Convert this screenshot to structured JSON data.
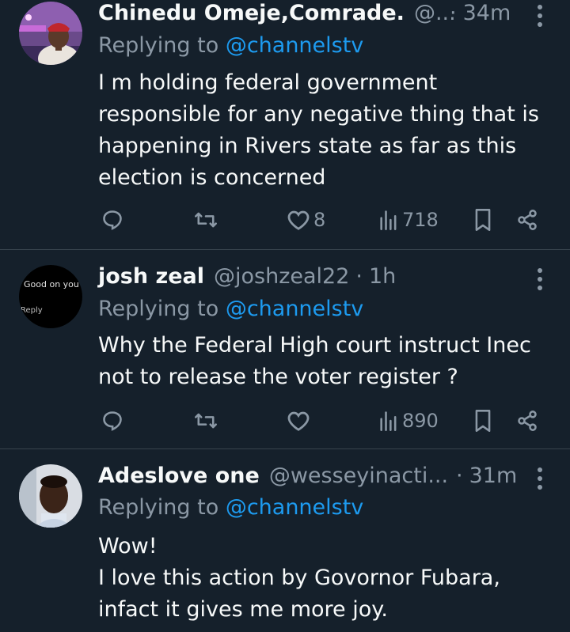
{
  "replying_prefix": "Replying to ",
  "colors": {
    "background": "#15202b",
    "primary_text": "#f7f9f9",
    "secondary_text": "#8b98a5",
    "link": "#1d9bf0",
    "divider": "#38444d"
  },
  "tweets": [
    {
      "name": "Chinedu Omeje,Comrade.",
      "handle": "@...",
      "dot": "·",
      "time": "34m",
      "reply_to": "@channelstv",
      "body": "I m holding federal government responsible for any negative thing that is happening in Rivers state as far as this election is concerned",
      "likes": "8",
      "views": "718"
    },
    {
      "name": "josh zeal",
      "handle": "@joshzeal22",
      "dot": "·",
      "time": "1h",
      "reply_to": "@channelstv",
      "body": "Why the Federal High court instruct Inec not to release the voter register ?",
      "likes": "",
      "views": "890",
      "avatar_text_1": "Good on you",
      "avatar_text_2": "Reply"
    },
    {
      "name": "Adeslove one",
      "handle": "@wesseyinacti...",
      "dot": "·",
      "time": "31m",
      "reply_to": "@channelstv",
      "body_lines": [
        "Wow!",
        "I love this action by Govornor Fubara, infact it gives me more joy."
      ]
    }
  ]
}
